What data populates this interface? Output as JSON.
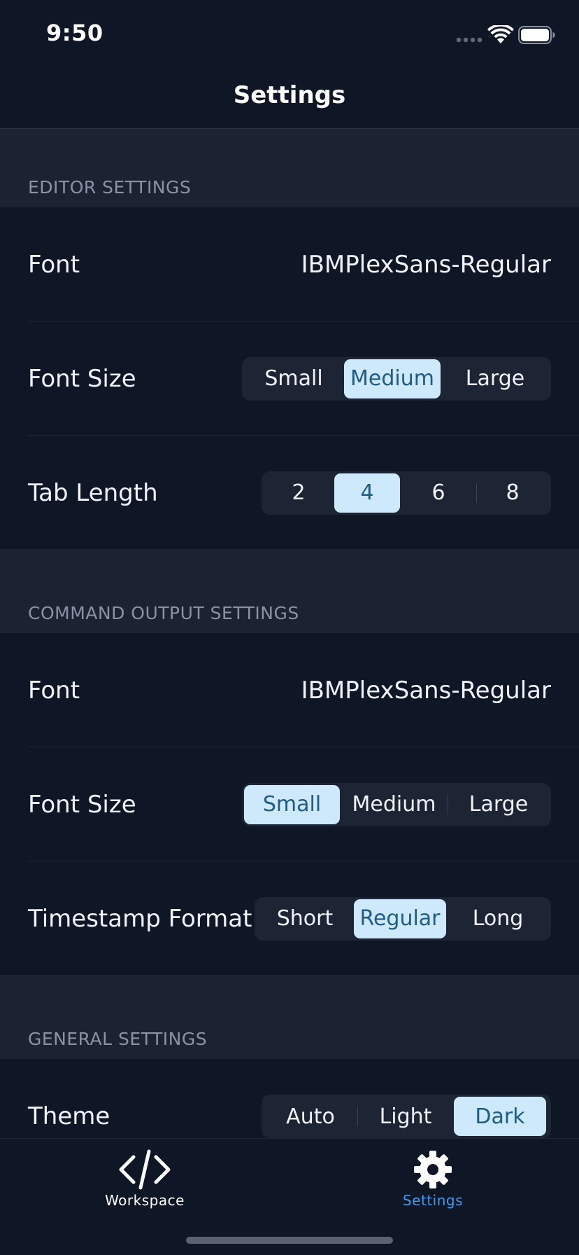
{
  "status_bar": {
    "time": "9:50"
  },
  "nav": {
    "title": "Settings"
  },
  "editor_settings": {
    "header": "EDITOR SETTINGS",
    "font_label": "Font",
    "font_value": "IBMPlexSans-Regular",
    "font_size_label": "Font Size",
    "font_size_options": [
      "Small",
      "Medium",
      "Large"
    ],
    "font_size_selected": "Medium",
    "tab_length_label": "Tab Length",
    "tab_length_options": [
      "2",
      "4",
      "6",
      "8"
    ],
    "tab_length_selected": "4"
  },
  "command_output_settings": {
    "header": "COMMAND OUTPUT SETTINGS",
    "font_label": "Font",
    "font_value": "IBMPlexSans-Regular",
    "font_size_label": "Font Size",
    "font_size_options": [
      "Small",
      "Medium",
      "Large"
    ],
    "font_size_selected": "Small",
    "timestamp_label": "Timestamp Format",
    "timestamp_options": [
      "Short",
      "Regular",
      "Long"
    ],
    "timestamp_selected": "Regular"
  },
  "general_settings": {
    "header": "GENERAL SETTINGS",
    "theme_label": "Theme",
    "theme_options": [
      "Auto",
      "Light",
      "Dark"
    ],
    "theme_selected": "Dark"
  },
  "tab_bar": {
    "items": [
      {
        "label": "Workspace",
        "icon": "code-brackets-icon",
        "active": false
      },
      {
        "label": "Settings",
        "icon": "gear-icon",
        "active": true
      }
    ]
  },
  "colors": {
    "background": "#0f1626",
    "section_header_bg": "#1b2333",
    "segment_bg": "#1d2535",
    "segment_selected": "#cde9fb",
    "segment_selected_text": "#1f5c86",
    "active_tab": "#3d9bf0",
    "inactive_tab": "#ffffff"
  }
}
